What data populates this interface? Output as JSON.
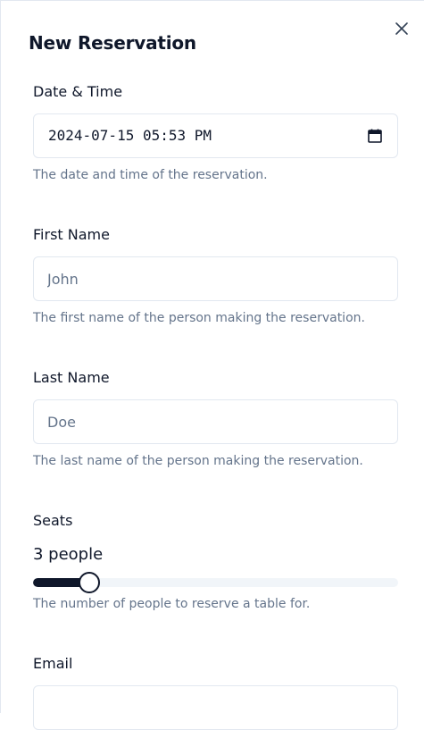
{
  "dialog": {
    "title": "New Reservation",
    "close_icon": "close-icon"
  },
  "date_time": {
    "label": "Date & Time",
    "value": "2024-07-15 05:53 PM",
    "icon": "calendar-icon",
    "help": "The date and time of the reservation."
  },
  "first_name": {
    "label": "First Name",
    "placeholder": "John",
    "value": "",
    "help": "The first name of the person making the reservation."
  },
  "last_name": {
    "label": "Last Name",
    "placeholder": "Doe",
    "value": "",
    "help": "The last name of the person making the reservation."
  },
  "seats": {
    "label": "Seats",
    "value_text": "3 people",
    "value": 3,
    "slider_fraction": 0.155,
    "help": "The number of people to reserve a table for."
  },
  "email": {
    "label": "Email"
  },
  "colors": {
    "accent": "#0f172a",
    "muted": "#64748b",
    "border": "#e2e8f0",
    "track": "#f1f5f9"
  }
}
